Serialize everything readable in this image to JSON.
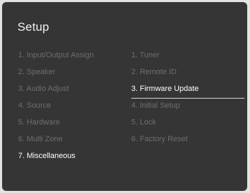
{
  "setup": {
    "title": "Setup",
    "left_menu": [
      {
        "label": "1. Input/Output Assign",
        "state": "dim"
      },
      {
        "label": "2. Speaker",
        "state": "dim"
      },
      {
        "label": "3. Audio Adjust",
        "state": "dim"
      },
      {
        "label": "4. Source",
        "state": "dim"
      },
      {
        "label": "5. Hardware",
        "state": "dim"
      },
      {
        "label": "6. Multi Zone",
        "state": "dim"
      },
      {
        "label": "7. Miscellaneous",
        "state": "active"
      }
    ],
    "right_menu": [
      {
        "label": "1. Tuner",
        "state": "dim"
      },
      {
        "label": "2. Remote ID",
        "state": "dim"
      },
      {
        "label": "3. Firmware Update",
        "state": "selected"
      },
      {
        "label": "4. Initial Setup",
        "state": "dim"
      },
      {
        "label": "5. Lock",
        "state": "dim"
      },
      {
        "label": "6. Factory Reset",
        "state": "dim"
      }
    ]
  },
  "colors": {
    "background": "#353535",
    "dim_text": "#6e6e6e",
    "active_text": "#ffffff",
    "frame": "#e3e3e3"
  }
}
